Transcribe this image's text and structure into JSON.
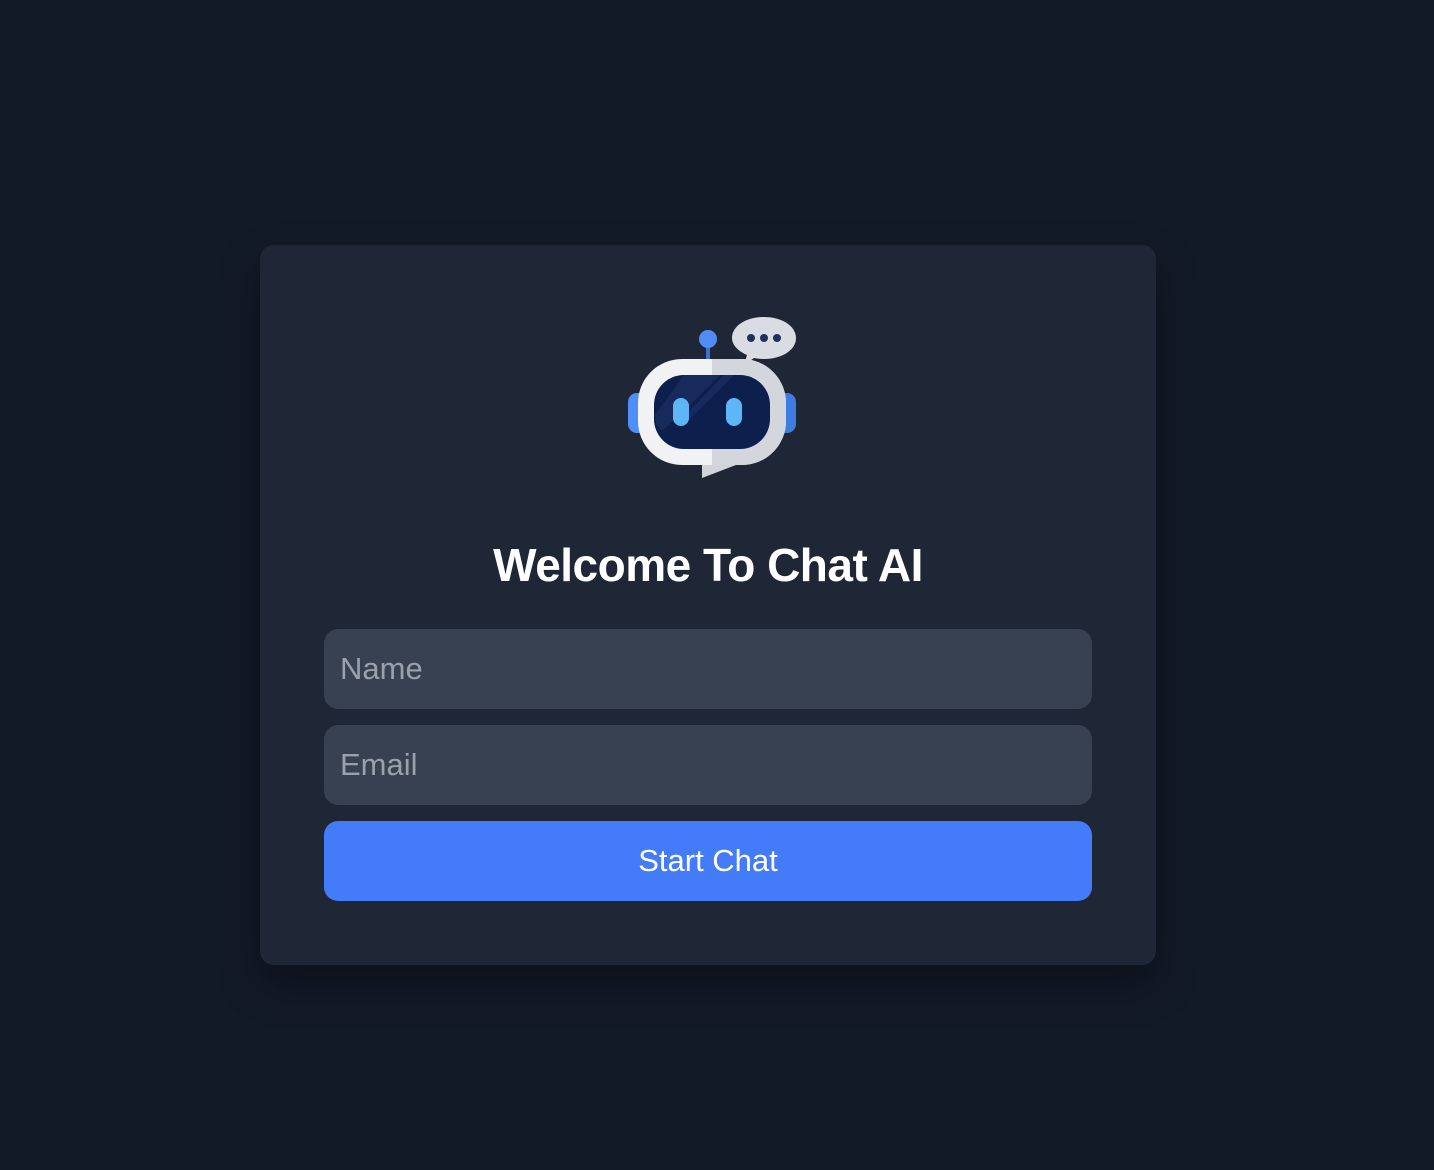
{
  "app": {
    "logo_icon": "robot-chat-icon",
    "title": "Welcome To Chat AI"
  },
  "form": {
    "name_placeholder": "Name",
    "name_value": "",
    "email_placeholder": "Email",
    "email_value": "",
    "submit_label": "Start Chat"
  },
  "colors": {
    "background": "#131a27",
    "card": "#1f2737",
    "input": "#374151",
    "accent": "#437bf8",
    "text": "#ffffff",
    "placeholder": "#9aa1ad"
  }
}
